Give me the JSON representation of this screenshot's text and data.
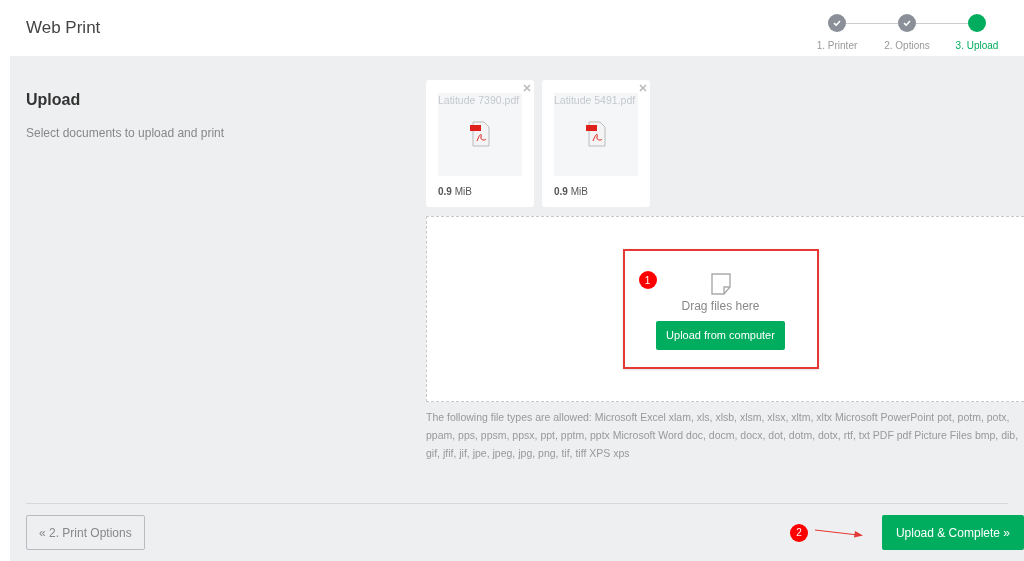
{
  "app_title": "Web Print",
  "steps": [
    {
      "label": "1. Printer",
      "completed": true,
      "selected": false
    },
    {
      "label": "2. Options",
      "completed": true,
      "selected": false
    },
    {
      "label": "3. Upload",
      "completed": false,
      "selected": true
    }
  ],
  "section": {
    "title": "Upload",
    "description": "Select documents to upload and print"
  },
  "files": [
    {
      "name": "Latitude 7390.pdf",
      "size_value": "0.9",
      "size_unit": "MiB"
    },
    {
      "name": "Latitude 5491.pdf",
      "size_value": "0.9",
      "size_unit": "MiB"
    }
  ],
  "dropzone": {
    "hint": "Drag files here",
    "button": "Upload from computer",
    "badge": "1"
  },
  "allowed_types": "The following file types are allowed: Microsoft Excel xlam, xls, xlsb, xlsm, xlsx, xltm, xltx Microsoft PowerPoint pot, potm, potx, ppam, pps, ppsm, ppsx, ppt, pptm, pptx Microsoft Word doc, docm, docx, dot, dotm, dotx, rtf, txt PDF pdf Picture Files bmp, dib, gif, jfif, jif, jpe, jpeg, jpg, png, tif, tiff XPS xps",
  "footer": {
    "back_button": "« 2. Print Options",
    "next_button": "Upload & Complete »",
    "next_badge": "2"
  }
}
